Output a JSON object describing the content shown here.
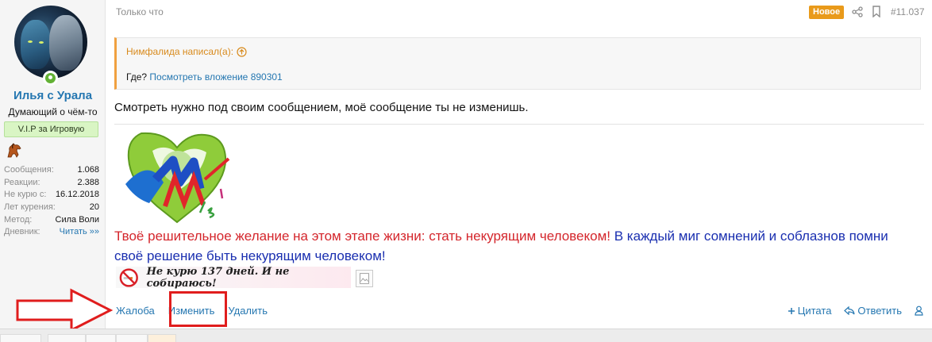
{
  "user": {
    "name": "Илья с Урала",
    "title": "Думающий о чём-то",
    "banner": "V.I.P за Игровую",
    "stats": [
      {
        "label": "Сообщения:",
        "value": "1.068"
      },
      {
        "label": "Реакции:",
        "value": "2.388"
      },
      {
        "label": "Не курю с:",
        "value": "16.12.2018"
      },
      {
        "label": "Лет курения:",
        "value": "20"
      },
      {
        "label": "Метод:",
        "value": "Сила Воли"
      },
      {
        "label": "Дневник:",
        "value": "Читать »»"
      }
    ]
  },
  "post": {
    "time": "Только что",
    "badge": "Новое",
    "number": "#11.037",
    "quote": {
      "author": "Нимфалида написал(а):",
      "text_prefix": "Где?",
      "link": "Посмотреть вложение 890301"
    },
    "message": "Смотреть нужно под своим сообщением, моё сообщение ты не изменишь.",
    "signature": {
      "red_text": "Твоё решительное желание на этом этапе жизни: стать некурящим человеком!",
      "blue_text": "В каждый миг сомнений и соблазнов помни своё решение быть некурящим человеком!",
      "nosmoke_text": "Не курю 137 дней. И не собираюсь!"
    },
    "actions_left": [
      "Жалоба",
      "Изменить",
      "Удалить"
    ],
    "actions_right": [
      "Цитата",
      "Ответить"
    ]
  },
  "colors": {
    "link": "#2577b1",
    "badge": "#e99a1a",
    "quote_accent": "#f0a040",
    "highlight": "#e01d1d"
  }
}
